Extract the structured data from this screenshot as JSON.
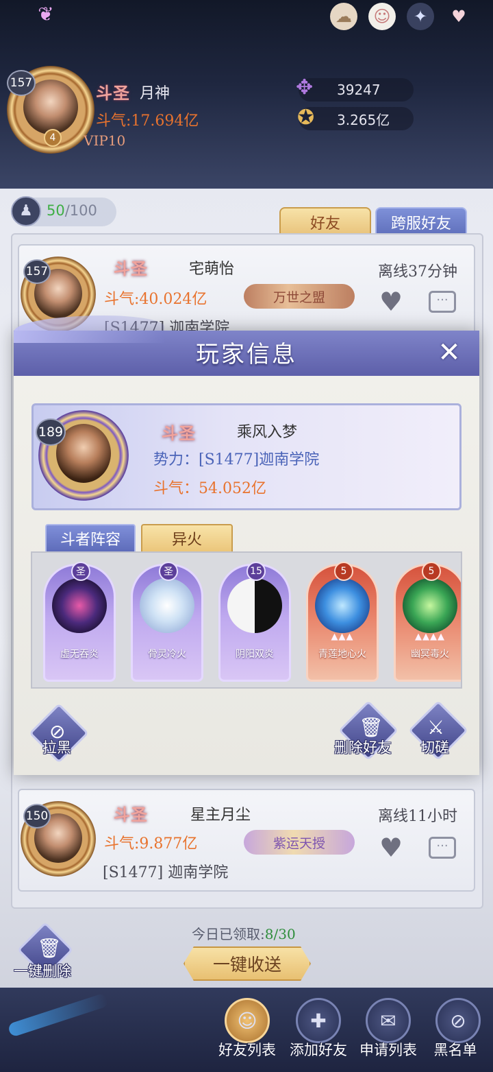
{
  "header": {
    "level": "157",
    "vip_level": "4",
    "title": "斗圣",
    "player_name": "月神",
    "power_label": "斗气:",
    "power_value": "17.694亿",
    "vip": "VIP10",
    "resource1": "39247",
    "resource2": "3.265亿"
  },
  "friends_panel": {
    "slots_current": "50",
    "slots_max": "/100",
    "tabs": [
      "好友",
      "跨服好友"
    ],
    "active_tab": "好友"
  },
  "friends": [
    {
      "level": "157",
      "title": "斗圣",
      "name": "宅萌怡",
      "power_label": "斗气:",
      "power_value": "40.024亿",
      "guild": "[S1477] 迦南学院",
      "badge": "万世之盟",
      "status": "离线37分钟"
    },
    {
      "level": "150",
      "title": "斗圣",
      "name": "星主月尘",
      "power_label": "斗气:",
      "power_value": "9.877亿",
      "guild": "[S1477] 迦南学院",
      "badge": "紫运天授",
      "status": "离线11小时"
    }
  ],
  "modal": {
    "title": "玩家信息",
    "player": {
      "level": "189",
      "title": "斗圣",
      "name": "乘风入梦",
      "faction_label": "势力：",
      "faction_value": "[S1477]迦南学院",
      "power_label": "斗气：",
      "power_value": "54.052亿"
    },
    "tabs": [
      "斗者阵容",
      "异火"
    ],
    "active_tab": "异火",
    "fires": [
      {
        "badge": "圣",
        "name": "虚无吞炎",
        "style": "purple",
        "stars": ""
      },
      {
        "badge": "圣",
        "name": "骨灵冷火",
        "style": "purple",
        "stars": ""
      },
      {
        "badge": "15",
        "name": "阴阳双炎",
        "style": "purple",
        "stars": ""
      },
      {
        "badge": "5",
        "name": "青莲地心火",
        "style": "red",
        "stars": "▲▲▲"
      },
      {
        "badge": "5",
        "name": "幽冥毒火",
        "style": "red",
        "stars": "▲▲▲▲"
      }
    ],
    "actions": {
      "block": "拉黑",
      "delete_friend": "删除好友",
      "spar": "切磋"
    }
  },
  "bottom": {
    "claim_label": "今日已领取:",
    "claim_value": "8/30",
    "one_click_send": "一键收送",
    "delete_all": "一键删除",
    "nav": [
      "好友列表",
      "添加好友",
      "申请列表",
      "黑名单"
    ],
    "active_nav": "好友列表"
  },
  "colors": {
    "modal_header": "#5d5fa9",
    "title_pink": "#f0a39c",
    "power_orange": "#e8732e",
    "faction_blue": "#4a63b8",
    "claim_green": "#2e8d3b"
  }
}
